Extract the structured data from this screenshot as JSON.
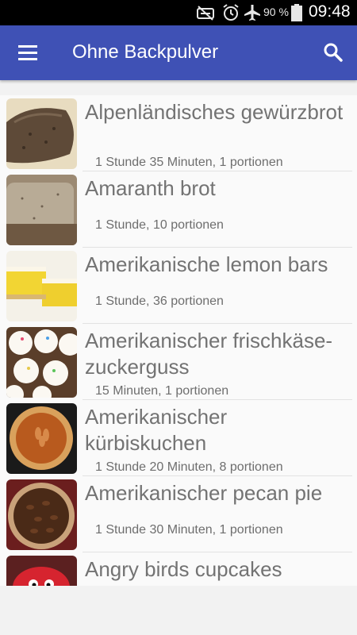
{
  "status_bar": {
    "battery_percent": "90 %",
    "time": "09:48",
    "icons": [
      "mute-icon",
      "alarm-icon",
      "airplane-mode-icon",
      "battery-icon"
    ]
  },
  "app_bar": {
    "title": "Ohne Backpulver",
    "menu_icon": "menu-icon",
    "search_icon": "search-icon",
    "color": "#3f51b5"
  },
  "recipes": [
    {
      "title": "Alpenländisches gewürzbrot",
      "meta": "1 Stunde 35 Minuten, 1 portionen"
    },
    {
      "title": "Amaranth brot",
      "meta": "1 Stunde, 10 portionen"
    },
    {
      "title": "Amerikanische lemon bars",
      "meta": "1 Stunde, 36 portionen"
    },
    {
      "title": "Amerikanischer frischkäse-zuckerguss",
      "meta": "15 Minuten, 1 portionen"
    },
    {
      "title": "Amerikanischer kürbiskuchen",
      "meta": "1 Stunde 20 Minuten, 8 portionen"
    },
    {
      "title": "Amerikanischer pecan pie",
      "meta": "1 Stunde 30 Minuten, 1 portionen"
    },
    {
      "title": "Angry birds cupcakes",
      "meta": ""
    }
  ]
}
